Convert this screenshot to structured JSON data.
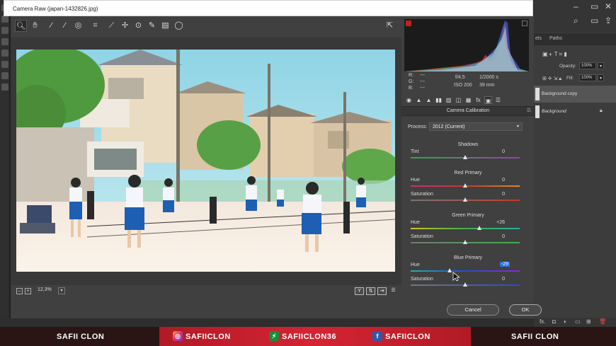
{
  "window": {
    "title": "Camera Raw (japan-1432826.jpg)"
  },
  "toolbar": {
    "tools": [
      {
        "name": "zoom-tool",
        "glyph": "🔍︎"
      },
      {
        "name": "hand-tool",
        "glyph": "✋︎"
      },
      {
        "name": "white-balance-tool",
        "glyph": "⁄"
      },
      {
        "name": "color-sampler-tool",
        "glyph": "⁄"
      },
      {
        "name": "targeted-adjustment-tool",
        "glyph": "◎"
      },
      {
        "name": "crop-tool",
        "glyph": "⌗"
      },
      {
        "name": "straighten-tool",
        "glyph": "⟋"
      },
      {
        "name": "spot-removal-tool",
        "glyph": "✢"
      },
      {
        "name": "red-eye-tool",
        "glyph": "⊙"
      },
      {
        "name": "adjustment-brush-tool",
        "glyph": "✎"
      },
      {
        "name": "graduated-filter-tool",
        "glyph": "▤"
      },
      {
        "name": "radial-filter-tool",
        "glyph": "◯"
      }
    ],
    "export_glyph": "⇱"
  },
  "readout": {
    "r_label": "R:",
    "g_label": "G:",
    "b_label": "B:",
    "r_val": "---",
    "g_val": "---",
    "b_val": "---",
    "aperture": "f/4,5",
    "shutter": "1/2000 s",
    "iso": "ISO 200",
    "focal": "39 mm"
  },
  "panel_tabs": [
    "◉",
    "▲",
    "▲",
    "▮▮",
    "▥",
    "◫",
    "▦",
    "fx",
    "▣",
    "☰"
  ],
  "panel": {
    "title": "Camera Calibration",
    "process_label": "Process:",
    "process_value": "2012 (Current)",
    "sections": [
      {
        "title": "Shadows",
        "sliders": [
          {
            "label": "Tint",
            "value": "0"
          }
        ]
      },
      {
        "title": "Red Primary",
        "sliders": [
          {
            "label": "Hue",
            "value": "0"
          },
          {
            "label": "Saturation",
            "value": "0"
          }
        ]
      },
      {
        "title": "Green Primary",
        "sliders": [
          {
            "label": "Hue",
            "value": "+26"
          },
          {
            "label": "Saturation",
            "value": "0"
          }
        ]
      },
      {
        "title": "Blue Primary",
        "sliders": [
          {
            "label": "Hue",
            "value": "-29"
          },
          {
            "label": "Saturation",
            "value": "0"
          }
        ]
      }
    ]
  },
  "slider_levels": {
    "shadows_tint": 0,
    "red_hue": 0,
    "red_sat": 0,
    "green_hue": 26,
    "green_sat": 0,
    "blue_hue": -29,
    "blue_sat": 0
  },
  "zoom": {
    "value": "12,3%"
  },
  "buttons": {
    "cancel": "Cancel",
    "ok": "OK"
  },
  "ps": {
    "tabs": [
      "els",
      "Paths"
    ],
    "opacity_label": "Opacity:",
    "opacity_value": "100%",
    "fill_label": "Fill:",
    "fill_value": "100%",
    "layers": [
      {
        "name": "Background copy"
      },
      {
        "name": "Background"
      }
    ],
    "fx_label": "fx."
  },
  "banner": {
    "left_name": "SAFII CLON",
    "instagram": "SAFIICLON",
    "other": "SAFIICLON36",
    "facebook": "SAFIICLON",
    "right_name": "SAFII CLON"
  },
  "colors": {
    "accent": "#2f6fd8",
    "banner_red": "#c41e2a"
  }
}
